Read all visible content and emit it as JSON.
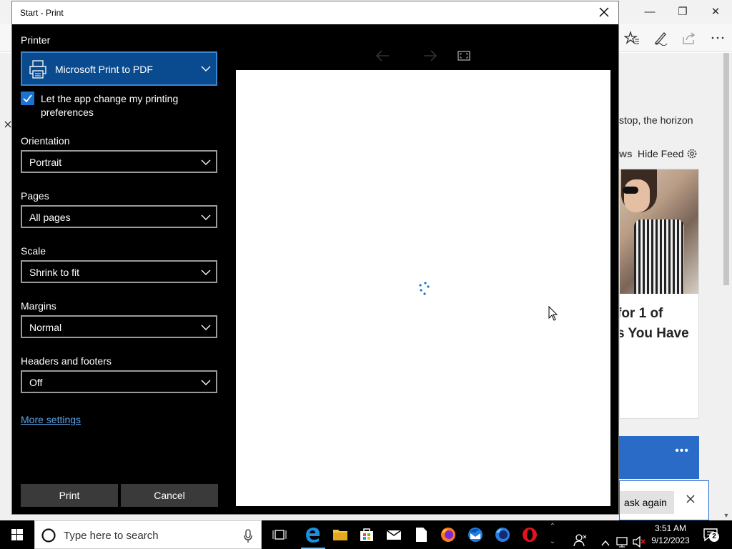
{
  "dialog": {
    "title": "Start - Print",
    "printer_label": "Printer",
    "printer_value": "Microsoft Print to PDF",
    "let_app_change": "Let the app change my printing preferences",
    "let_app_change_checked": true,
    "orientation_label": "Orientation",
    "orientation_value": "Portrait",
    "pages_label": "Pages",
    "pages_value": "All pages",
    "scale_label": "Scale",
    "scale_value": "Shrink to fit",
    "margins_label": "Margins",
    "margins_value": "Normal",
    "headers_label": "Headers and footers",
    "headers_value": "Off",
    "more_settings": "More settings",
    "print_button": "Print",
    "cancel_button": "Cancel"
  },
  "background": {
    "headline_fragment": "stop, the horizon",
    "news_fragment": "ws",
    "hide_feed": "Hide Feed",
    "card_title_line1": "for 1 of",
    "card_title_line2": "s You Have",
    "ask_again": "ask again"
  },
  "taskbar": {
    "search_placeholder": "Type here to search",
    "time": "3:51 AM",
    "date": "9/12/2023",
    "notification_count": "2"
  },
  "colors": {
    "accent": "#0a4b8f",
    "link": "#5ba3e8",
    "checkbox": "#1a72d1"
  }
}
